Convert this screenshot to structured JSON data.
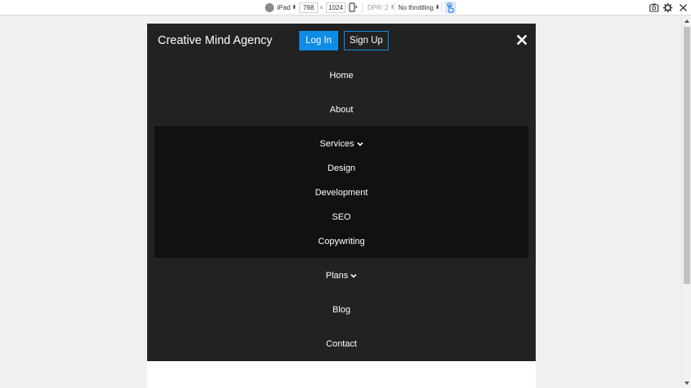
{
  "devtools": {
    "device": "iPad",
    "width": "768",
    "times": "×",
    "height": "1024",
    "dpr": "DPR: 2",
    "throttling": "No throttling"
  },
  "brand": "Creative Mind Agency",
  "auth": {
    "login_label": "Log In",
    "signup_label": "Sign Up"
  },
  "nav": {
    "home": "Home",
    "about": "About",
    "services": {
      "label": "Services",
      "items": [
        "Design",
        "Development",
        "SEO",
        "Copywriting"
      ]
    },
    "plans": "Plans",
    "blog": "Blog",
    "contact": "Contact"
  },
  "colors": {
    "accent": "#0f8ce6",
    "nav_bg": "#222222",
    "dropdown_bg": "#111111",
    "text": "#ffffff"
  }
}
